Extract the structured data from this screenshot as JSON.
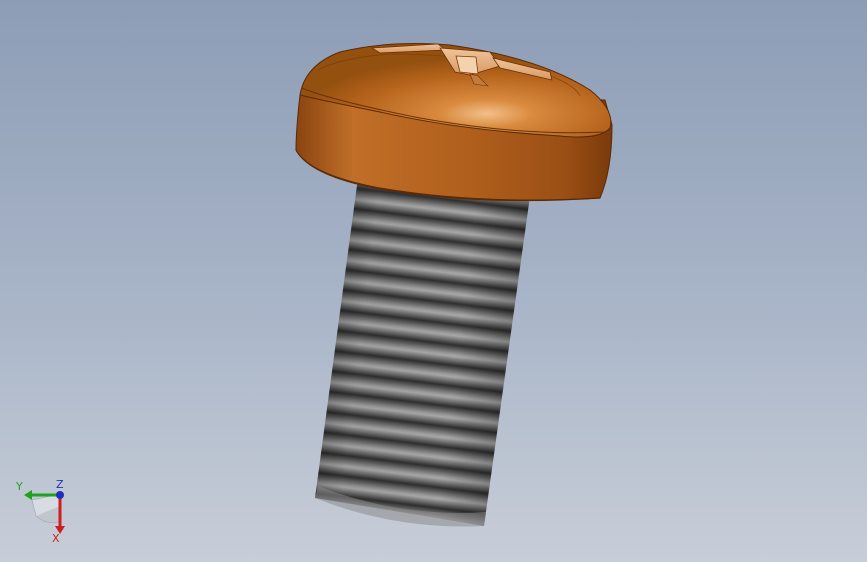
{
  "viewport": {
    "background_top": "#8d9db6",
    "background_bottom": "#c8ced8"
  },
  "model": {
    "part": "pan-head-cross-recessed-screw",
    "head_color": "#b5631c",
    "thread_color": "#4a4a4a"
  },
  "triad": {
    "x_label": "X",
    "y_label": "Y",
    "z_label": "Z",
    "x_color": "#cc1f1f",
    "y_color": "#1fa31f",
    "z_color": "#1f2fbf"
  }
}
